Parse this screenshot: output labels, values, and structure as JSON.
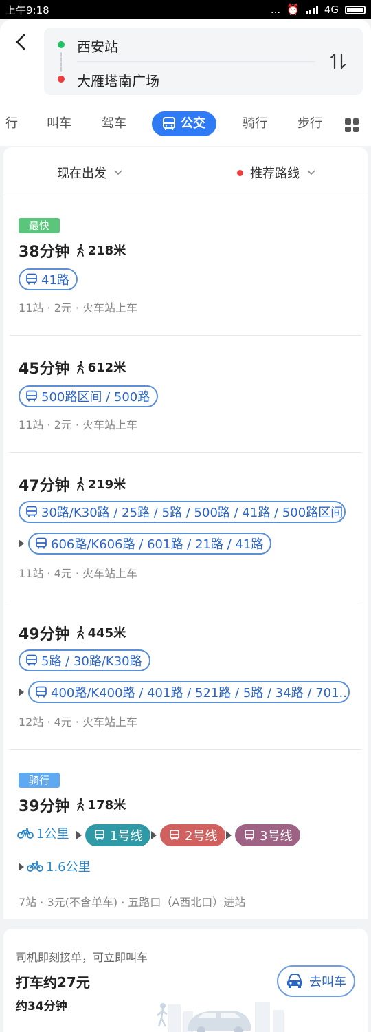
{
  "status_bar": {
    "time": "上午9:18",
    "network": "4G",
    "dots": "..."
  },
  "header": {
    "from": "西安站",
    "to": "大雁塔南广场",
    "tabs": [
      "行",
      "叫车",
      "驾车",
      "公交",
      "骑行",
      "步行"
    ],
    "active_tab": "公交"
  },
  "filters": {
    "depart": "现在出发",
    "route_pref": "推荐路线"
  },
  "routes": [
    {
      "tag": "最快",
      "time": "38分钟",
      "walk": "218米",
      "lines": [
        "41路"
      ],
      "meta": "11站 · 2元 · 火车站上车"
    },
    {
      "time": "45分钟",
      "walk": "612米",
      "lines": [
        "500路区间 / 500路"
      ],
      "meta": "11站 · 2元 · 火车站上车"
    },
    {
      "time": "47分钟",
      "walk": "219米",
      "lines": [
        "30路/K30路 / 25路 / 5路 / 500路 / 41路 / 500路区间",
        "606路/K606路 / 601路 / 21路 / 41路"
      ],
      "meta": "11站 · 4元 · 火车站上车"
    },
    {
      "time": "49分钟",
      "walk": "445米",
      "lines": [
        "5路 / 30路/K30路",
        "400路/K400路 / 401路 / 521路 / 5路 / 34路 / 701..."
      ],
      "meta": "12站 · 4元 · 火车站上车"
    },
    {
      "tag": "骑行",
      "time": "39分钟",
      "walk": "178米",
      "bike1": "1公里",
      "metro": [
        "1号线",
        "2号线",
        "3号线"
      ],
      "bike2": "1.6公里",
      "meta": "7站 · 3元(不含单车) · 五路口（A西北口）进站"
    }
  ],
  "taxi": {
    "hint": "司机即刻接单，可立即叫车",
    "price": "打车约27元",
    "duration": "约34分钟",
    "button": "去叫车"
  },
  "colors": {
    "accent": "#2f7af5",
    "tag_fastest": "#5bc67b",
    "tag_bike": "#5fa9f2",
    "metro_line1": "#2f9aa6",
    "metro_line2": "#d0615f",
    "metro_line3": "#9d6284"
  }
}
